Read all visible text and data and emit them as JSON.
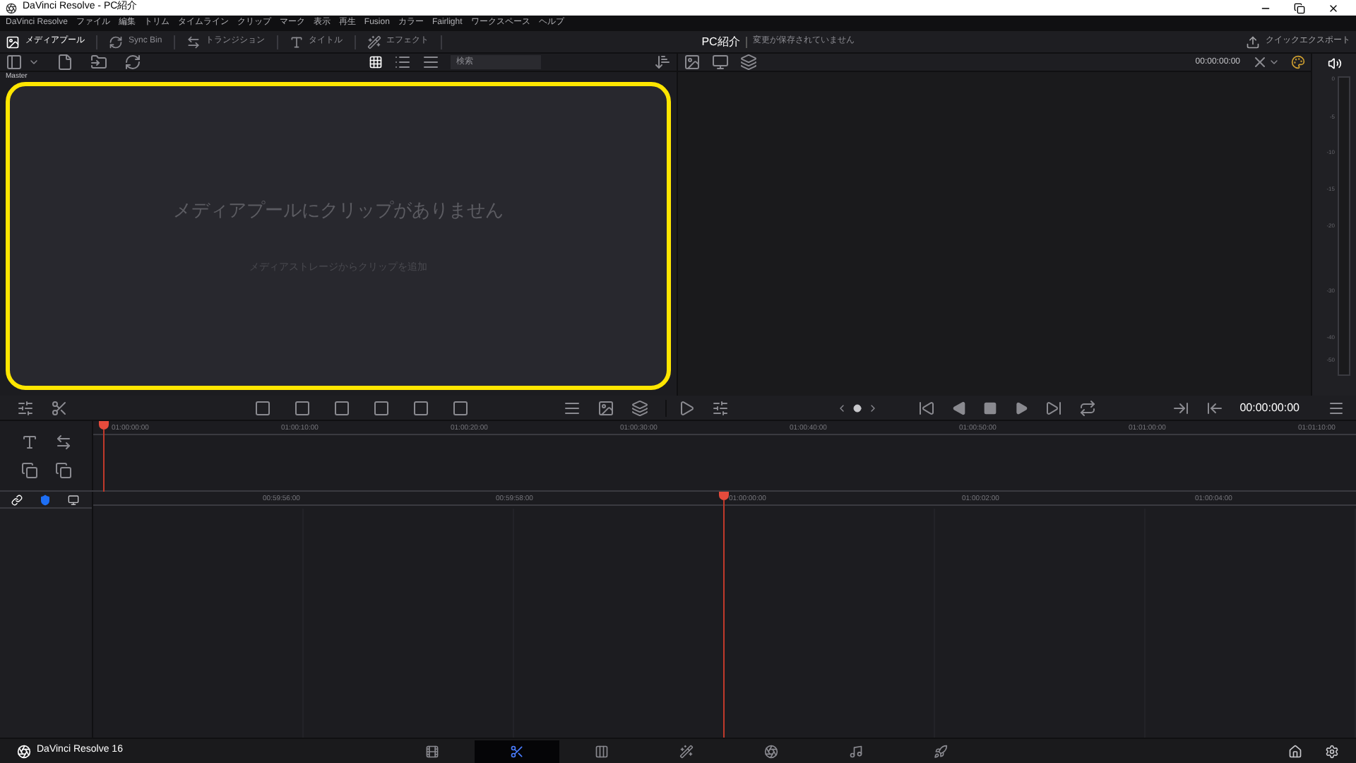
{
  "window": {
    "title": "DaVinci Resolve - PC紹介"
  },
  "menu": [
    "DaVinci Resolve",
    "ファイル",
    "編集",
    "トリム",
    "タイムライン",
    "クリップ",
    "マーク",
    "表示",
    "再生",
    "Fusion",
    "カラー",
    "Fairlight",
    "ワークスペース",
    "ヘルプ"
  ],
  "toolbar": {
    "tabs": [
      {
        "label": "メディアプール",
        "kind": "media",
        "selected": true
      },
      {
        "label": "Sync Bin",
        "kind": "sync",
        "selected": false
      },
      {
        "label": "トランジション",
        "kind": "transition",
        "selected": false
      },
      {
        "label": "タイトル",
        "kind": "title",
        "selected": false
      },
      {
        "label": "エフェクト",
        "kind": "effect",
        "selected": false
      }
    ],
    "project_name": "PC紹介",
    "project_status": "変更が保存されていません",
    "quick_export": "クイックエクスポート"
  },
  "media_pool": {
    "search_placeholder": "検索",
    "bin": "Master",
    "empty_title": "メディアプールにクリップがありません",
    "empty_hint": "メディアストレージからクリップを追加"
  },
  "viewer": {
    "timecode": "00:00:00:00"
  },
  "audio_meter": {
    "scale": [
      "0",
      "-5",
      "-10",
      "-15",
      "-20",
      "-30",
      "-40",
      "-50"
    ]
  },
  "transport": {
    "timecode": "00:00:00:00"
  },
  "upper_timeline": {
    "ticks": [
      "01:00:00:00",
      "01:00:10:00",
      "01:00:20:00",
      "01:00:30:00",
      "01:00:40:00",
      "01:00:50:00",
      "01:01:00:00",
      "01:01:10:00"
    ]
  },
  "lower_timeline": {
    "ticks": [
      "00:59:56:00",
      "00:59:58:00",
      "01:00:00:00",
      "01:00:02:00",
      "01:00:04:00"
    ]
  },
  "page_bar": {
    "app": "DaVinci Resolve 16",
    "pages": [
      {
        "kind": "media",
        "selected": false
      },
      {
        "kind": "cut",
        "selected": true
      },
      {
        "kind": "edit",
        "selected": false
      },
      {
        "kind": "fusion",
        "selected": false
      },
      {
        "kind": "color",
        "selected": false
      },
      {
        "kind": "fairlight",
        "selected": false
      },
      {
        "kind": "deliver",
        "selected": false
      }
    ]
  }
}
